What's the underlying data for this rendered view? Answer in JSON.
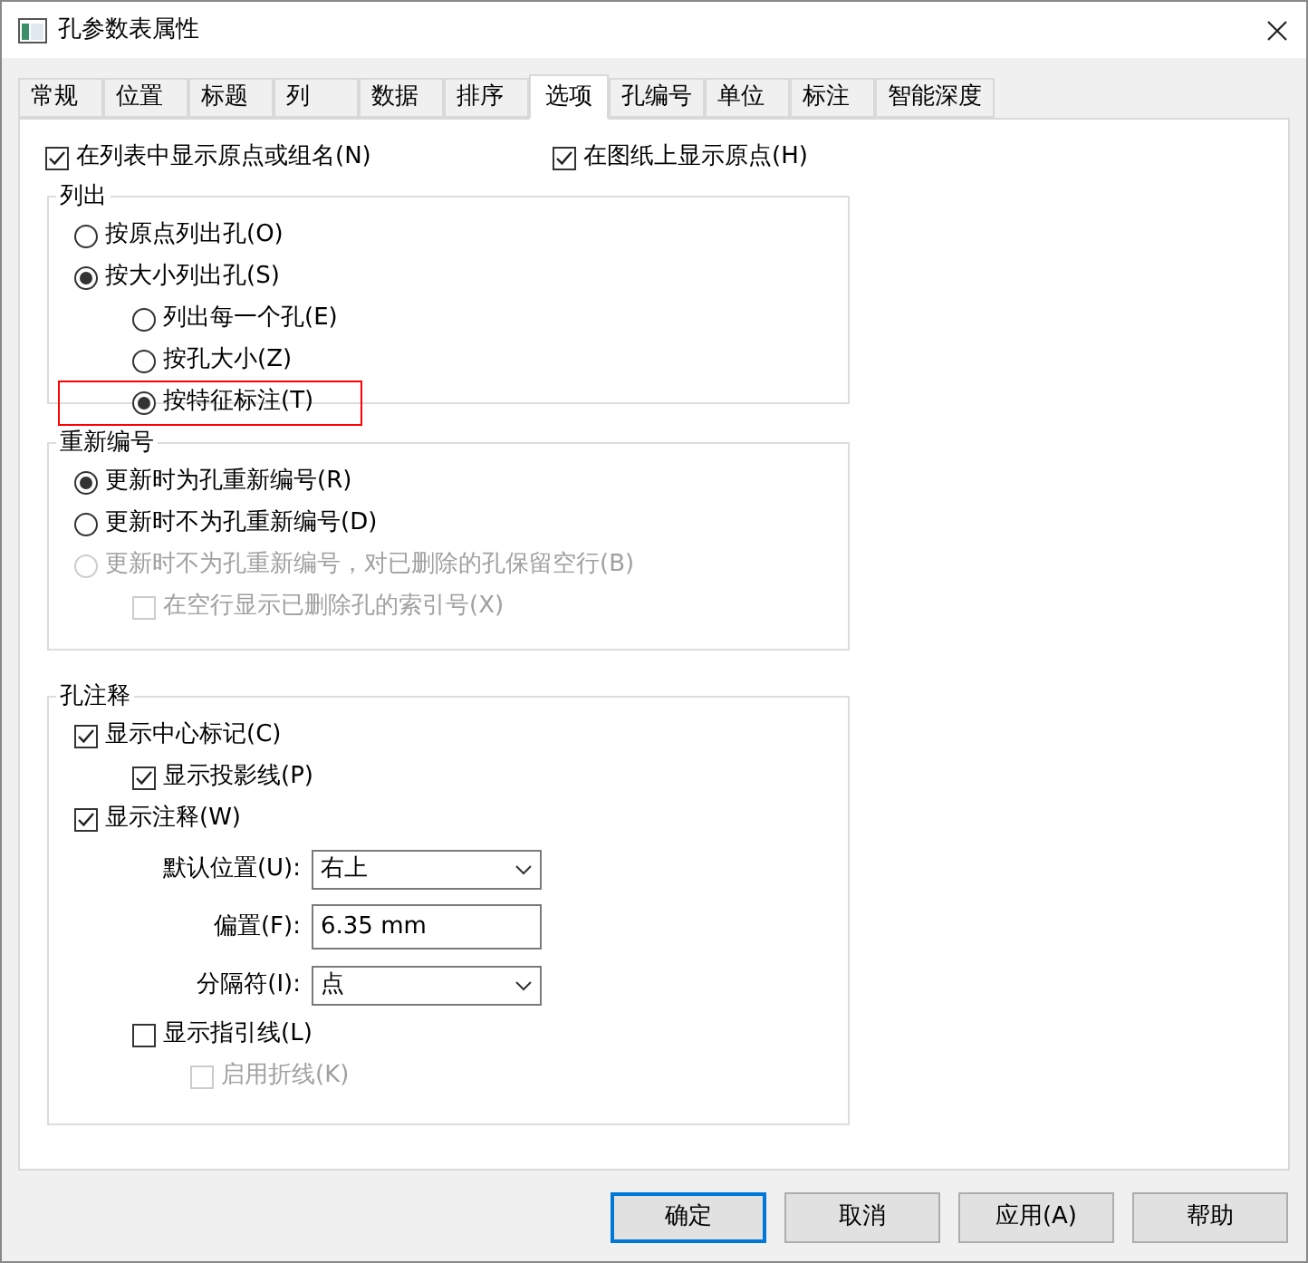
{
  "window": {
    "title": "孔参数表属性"
  },
  "tabs": [
    {
      "label": "常规",
      "selected": false
    },
    {
      "label": "位置",
      "selected": false
    },
    {
      "label": "标题",
      "selected": false
    },
    {
      "label": "列",
      "selected": false
    },
    {
      "label": "数据",
      "selected": false
    },
    {
      "label": "排序",
      "selected": false
    },
    {
      "label": "选项",
      "selected": true
    },
    {
      "label": "孔编号",
      "selected": false
    },
    {
      "label": "单位",
      "selected": false
    },
    {
      "label": "标注",
      "selected": false
    },
    {
      "label": "智能深度",
      "selected": false
    }
  ],
  "top_options": [
    {
      "label": "在列表中显示原点或组名(N)",
      "checked": true
    },
    {
      "label": "在图纸上显示原点(H)",
      "checked": true
    }
  ],
  "groups": [
    {
      "title": "列出",
      "items": [
        {
          "kind": "radio",
          "label": "按原点列出孔(O)",
          "selected": false,
          "disabled": false
        },
        {
          "kind": "radio",
          "label": "按大小列出孔(S)",
          "selected": true,
          "disabled": false,
          "children": [
            {
              "kind": "radio",
              "label": "列出每一个孔(E)",
              "selected": false,
              "disabled": false
            },
            {
              "kind": "radio",
              "label": "按孔大小(Z)",
              "selected": false,
              "disabled": false
            },
            {
              "kind": "radio",
              "label": "按特征标注(T)",
              "selected": true,
              "disabled": false,
              "highlighted": true
            }
          ]
        }
      ]
    },
    {
      "title": "重新编号",
      "items": [
        {
          "kind": "radio",
          "label": "更新时为孔重新编号(R)",
          "selected": true,
          "disabled": false
        },
        {
          "kind": "radio",
          "label": "更新时不为孔重新编号(D)",
          "selected": false,
          "disabled": false
        },
        {
          "kind": "radio",
          "label": "更新时不为孔重新编号，对已删除的孔保留空行(B)",
          "selected": false,
          "disabled": true,
          "children": [
            {
              "kind": "checkbox",
              "label": "在空行显示已删除孔的索引号(X)",
              "checked": false,
              "disabled": true
            }
          ]
        }
      ]
    },
    {
      "title": "孔注释",
      "items": [
        {
          "kind": "checkbox",
          "label": "显示中心标记(C)",
          "checked": true,
          "disabled": false,
          "children": [
            {
              "kind": "checkbox",
              "label": "显示投影线(P)",
              "checked": true,
              "disabled": false
            }
          ]
        },
        {
          "kind": "checkbox",
          "label": "显示注释(W)",
          "checked": true,
          "disabled": false,
          "children": [
            {
              "kind": "select",
              "label": "默认位置(U):",
              "value": "右上"
            },
            {
              "kind": "input",
              "label": "偏置(F):",
              "value": "6.35 mm"
            },
            {
              "kind": "select",
              "label": "分隔符(I):",
              "value": "点"
            },
            {
              "kind": "checkbox",
              "label": "显示指引线(L)",
              "checked": false,
              "disabled": false,
              "children": [
                {
                  "kind": "checkbox",
                  "label": "启用折线(K)",
                  "checked": false,
                  "disabled": true
                }
              ]
            }
          ]
        }
      ]
    }
  ],
  "buttons": [
    {
      "label": "确定",
      "default": true
    },
    {
      "label": "取消",
      "default": false
    },
    {
      "label": "应用(A)",
      "default": false
    },
    {
      "label": "帮助",
      "default": false
    }
  ]
}
